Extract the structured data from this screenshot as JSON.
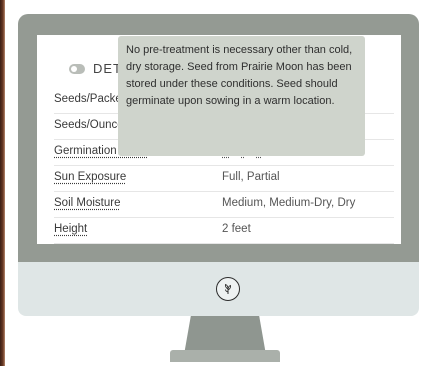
{
  "details": {
    "section_title": "DETAILS",
    "rows": [
      {
        "label": "Seeds/Packet",
        "value": ""
      },
      {
        "label": "Seeds/Ounce",
        "value": ""
      },
      {
        "label": "Germination Code",
        "codes": [
          "A",
          "I",
          "J"
        ]
      },
      {
        "label": "Sun Exposure",
        "value": "Full, Partial"
      },
      {
        "label": "Soil Moisture",
        "value": "Medium, Medium-Dry, Dry"
      },
      {
        "label": "Height",
        "value": "2 feet"
      }
    ]
  },
  "tooltip": {
    "text": "No pre-treatment is necessary other than cold, dry storage. Seed from Prairie Moon has been stored under these conditions. Seed should germinate upon sowing in a warm location."
  },
  "icons": {
    "section_toggle": "toggle-icon",
    "monitor_logo": "leaf-logo-icon"
  },
  "colors": {
    "monitor_bezel": "#949a93",
    "monitor_chin": "#dfe6e6",
    "tooltip_bg": "#cfd4cc"
  }
}
